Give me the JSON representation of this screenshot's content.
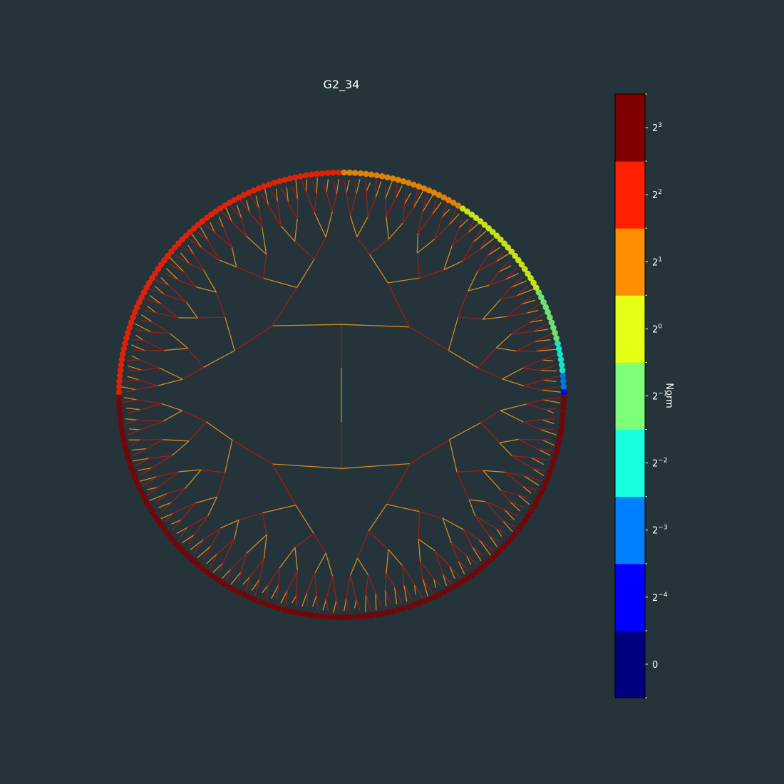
{
  "chart_data": {
    "type": "radial-dendrogram",
    "title": "G2_34",
    "leaf_count": 256,
    "depth": 8,
    "colorbar": {
      "label": "Norm",
      "bins": [
        {
          "label": "0",
          "base": "0",
          "exp": "",
          "color": "#00007f"
        },
        {
          "label": "2^-4",
          "base": "2",
          "exp": "−4",
          "color": "#0000ff"
        },
        {
          "label": "2^-3",
          "base": "2",
          "exp": "−3",
          "color": "#007fff"
        },
        {
          "label": "2^-2",
          "base": "2",
          "exp": "−2",
          "color": "#17ffdf"
        },
        {
          "label": "2^-1",
          "base": "2",
          "exp": "−1",
          "color": "#7dff7a"
        },
        {
          "label": "2^0",
          "base": "2",
          "exp": "0",
          "color": "#e4ff13"
        },
        {
          "label": "2^1",
          "base": "2",
          "exp": "1",
          "color": "#ff8f00"
        },
        {
          "label": "2^2",
          "base": "2",
          "exp": "2",
          "color": "#ff2000"
        },
        {
          "label": "2^3",
          "base": "2",
          "exp": "3",
          "color": "#7f0000"
        }
      ]
    },
    "edge_colors": [
      "#d48a1e",
      "#a51b12"
    ],
    "leaf_color_groups": [
      {
        "region": "upper half, left of top",
        "from_leaf_pct": 0,
        "to_leaf_pct": 50,
        "color": "#ff2000"
      },
      {
        "region": "upper half, right of top",
        "from_leaf_pct": 50,
        "to_leaf_pct": 68,
        "color": "#ff8f00"
      },
      {
        "region": "upper right",
        "from_leaf_pct": 68,
        "to_leaf_pct": 84,
        "color": "#e4ff13"
      },
      {
        "region": "right",
        "from_leaf_pct": 84,
        "to_leaf_pct": 92,
        "color": "#7dff7a"
      },
      {
        "region": "right",
        "from_leaf_pct": 92,
        "to_leaf_pct": 97,
        "color": "#17ffdf"
      },
      {
        "region": "right",
        "from_leaf_pct": 97,
        "to_leaf_pct": 99,
        "color": "#007fff"
      },
      {
        "region": "right",
        "from_leaf_pct": 99,
        "to_leaf_pct": 100,
        "color": "#0000ff"
      },
      {
        "region": "lower half",
        "color": "#7f0000"
      }
    ]
  }
}
